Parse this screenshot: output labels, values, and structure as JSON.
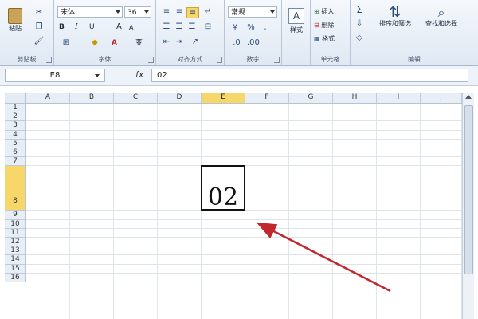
{
  "ribbon": {
    "clipboard": {
      "group_label": "剪贴板",
      "paste_label": "粘贴"
    },
    "font": {
      "group_label": "字体",
      "font_name": "宋体",
      "font_size": "36",
      "bold_label": "B",
      "italic_label": "I",
      "underline_label": "U",
      "grow_label": "A",
      "shrink_label": "A",
      "color_label": "A",
      "phonetic_label": "变"
    },
    "alignment": {
      "group_label": "对齐方式"
    },
    "number": {
      "group_label": "数字",
      "format_value": "常规"
    },
    "styles": {
      "label": "样式"
    },
    "cells": {
      "group_label": "单元格",
      "insert_label": "插入",
      "delete_label": "删除",
      "format_label": "格式"
    },
    "editing": {
      "group_label": "编辑",
      "sort_label": "排序和筛选",
      "find_label": "查找和选择"
    }
  },
  "formula_bar": {
    "name_box": "E8",
    "fx_label": "fx",
    "formula": "02"
  },
  "grid": {
    "columns": [
      "A",
      "B",
      "C",
      "D",
      "E",
      "F",
      "G",
      "H",
      "I",
      "J"
    ],
    "rows": [
      "1",
      "2",
      "3",
      "4",
      "5",
      "6",
      "7",
      "8",
      "9",
      "10",
      "11",
      "12",
      "13",
      "14",
      "15",
      "16"
    ],
    "selected_column": "E",
    "selected_row": "8",
    "active_cell_value": "02"
  },
  "annotation": {
    "arrow_color": "#c0282d"
  },
  "colors": {
    "selected_header": "#f7d66a",
    "ribbon_bg": "#dfe8f3"
  }
}
